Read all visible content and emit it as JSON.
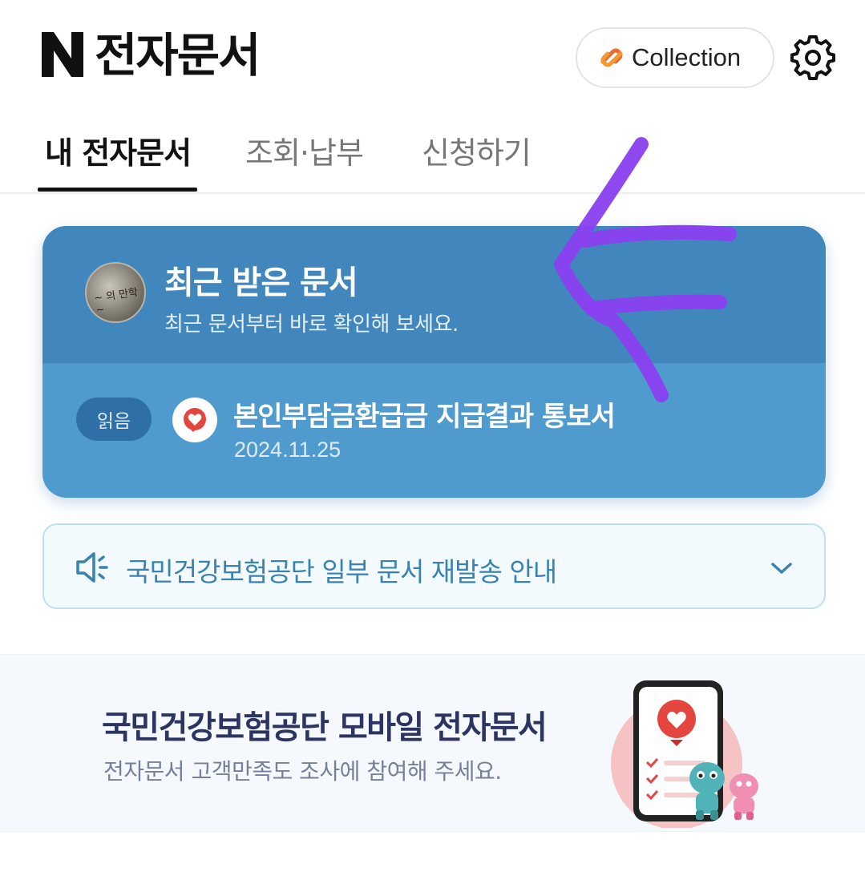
{
  "header": {
    "logo_letter": "N",
    "title": "전자문서",
    "collection_label": "Collection"
  },
  "tabs": [
    {
      "label": "내 전자문서",
      "active": true
    },
    {
      "label": "조회·납부",
      "active": false
    },
    {
      "label": "신청하기",
      "active": false
    }
  ],
  "recent_card": {
    "title": "최근 받은 문서",
    "subtitle": "최근 문서부터 바로 확인해 보세요.",
    "document": {
      "status_badge": "읽음",
      "title": "본인부담금환급금 지급결과 통보서",
      "date": "2024.11.25"
    }
  },
  "notice": {
    "text": "국민건강보험공단 일부 문서 재발송 안내"
  },
  "banner": {
    "title": "국민건강보험공단 모바일 전자문서",
    "subtitle": "전자문서 고객만족도 조사에 참여해 주세요."
  },
  "colors": {
    "card_top": "#4186bd",
    "card_bottom": "#4f9bce",
    "annotation": "#8a3ff0",
    "notice_text": "#3a82b0",
    "banner_title": "#2c3461"
  },
  "icons": [
    "logo-n-icon",
    "collection-link-icon",
    "gear-icon",
    "avatar-image",
    "nhis-heart-icon",
    "speaker-icon",
    "chevron-down-icon"
  ]
}
